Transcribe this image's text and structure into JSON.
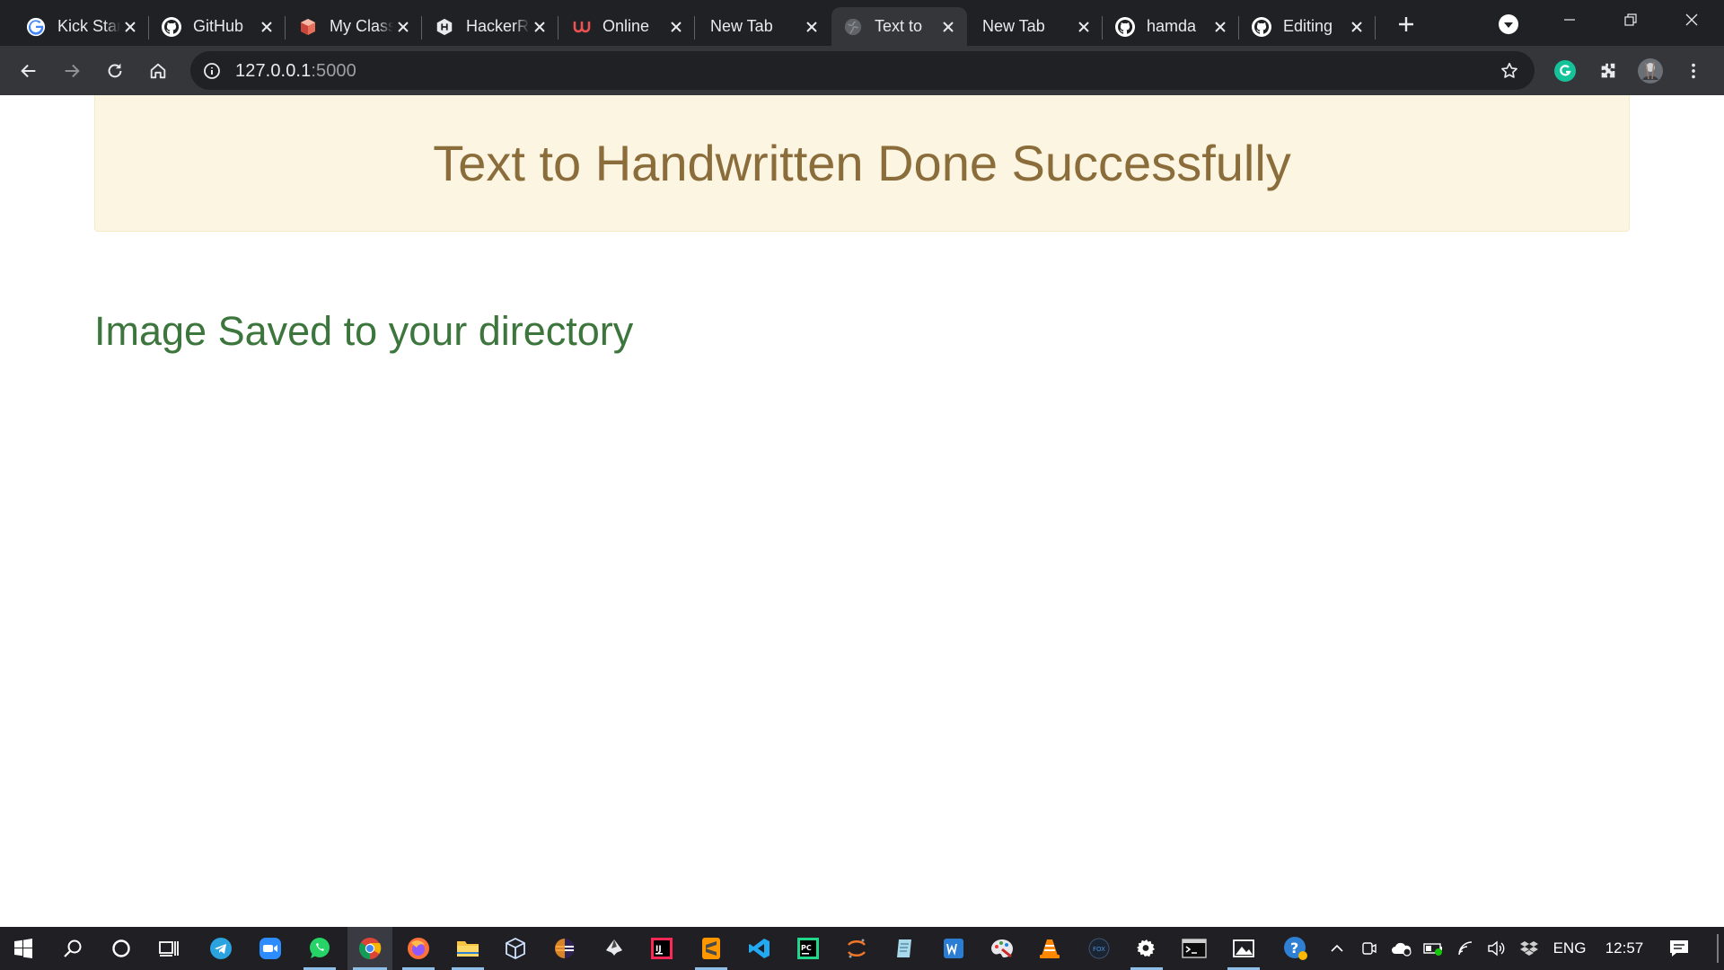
{
  "browser": {
    "tabs": [
      {
        "title": "Kick Start",
        "icon": "google-icon"
      },
      {
        "title": "GitHub",
        "icon": "github-icon"
      },
      {
        "title": "My Classes",
        "icon": "classroom-icon"
      },
      {
        "title": "HackerRank",
        "icon": "hackerrank-icon"
      },
      {
        "title": "Online",
        "icon": "udemy-icon"
      },
      {
        "title": "New Tab",
        "icon": ""
      },
      {
        "title": "Text to",
        "icon": "globe-icon"
      },
      {
        "title": "New Tab",
        "icon": ""
      },
      {
        "title": "hamda",
        "icon": "github-icon"
      },
      {
        "title": "Editing",
        "icon": "github-icon"
      }
    ],
    "active_tab": 6,
    "address": {
      "host": "127.0.0.1",
      "port": ":5000"
    }
  },
  "page": {
    "alert_message": "Text to Handwritten Done Successfully",
    "status_message": "Image Saved to your directory"
  },
  "taskbar": {
    "language": "ENG",
    "clock": "12:57"
  },
  "colors": {
    "alert_bg": "#fcf5e1",
    "alert_text": "#8a6d3b",
    "success_text": "#3c763d",
    "chrome_dark": "#202124",
    "chrome_toolbar": "#35363a"
  }
}
